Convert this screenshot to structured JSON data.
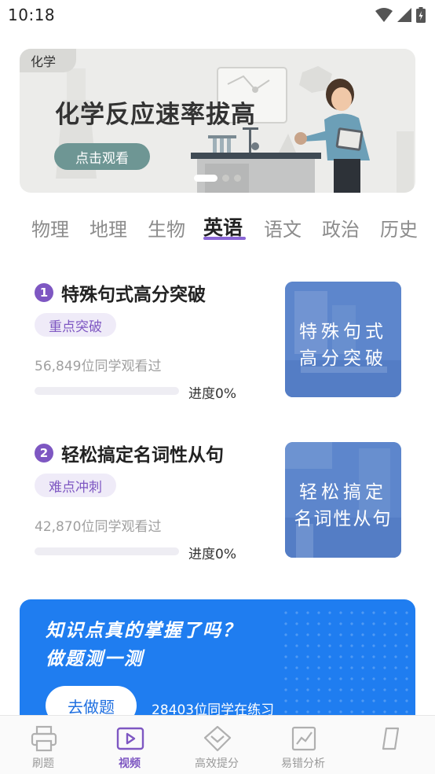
{
  "status_bar": {
    "time": "10:18"
  },
  "banner": {
    "tag": "化学",
    "title": "化学反应速率拔高",
    "button": "点击观看"
  },
  "tabs": [
    "物理",
    "地理",
    "生物",
    "英语",
    "语文",
    "政治",
    "历史"
  ],
  "active_tab": "英语",
  "courses": [
    {
      "number": "1",
      "title": "特殊句式高分突破",
      "tag": "重点突破",
      "views": "56,849位同学观看过",
      "progress_label": "进度0%",
      "progress": 0,
      "thumb_line1": "特殊句式",
      "thumb_line2": "高分突破"
    },
    {
      "number": "2",
      "title": "轻松搞定名词性从句",
      "tag": "难点冲刺",
      "views": "42,870位同学观看过",
      "progress_label": "进度0%",
      "progress": 0,
      "thumb_line1": "轻松搞定",
      "thumb_line2": "名词性从句"
    }
  ],
  "practice": {
    "line1": "知识点真的掌握了吗？",
    "line2": "做题测一测",
    "button": "去做题",
    "count": "28403位同学在练习"
  },
  "bottom_nav": [
    {
      "label": "刷题",
      "icon": "printer-icon"
    },
    {
      "label": "视频",
      "icon": "video-play-icon"
    },
    {
      "label": "高效提分",
      "icon": "chevron-badge-icon"
    },
    {
      "label": "易错分析",
      "icon": "chart-icon"
    },
    {
      "label": "",
      "icon": "notebook-icon"
    }
  ],
  "colors": {
    "accent": "#7e57c2",
    "practice_bg": "#1f7df0",
    "banner_button": "#6e9694",
    "thumb_bg": "#5d86cc"
  }
}
